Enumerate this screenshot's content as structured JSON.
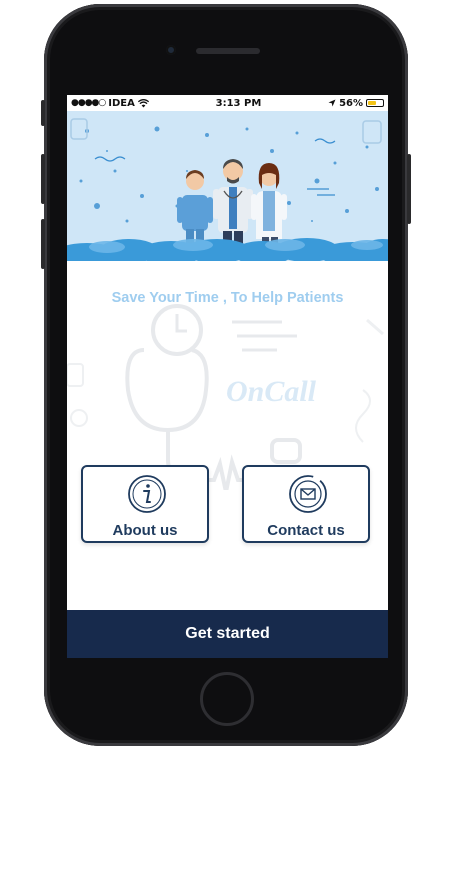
{
  "status_bar": {
    "carrier": "IDEA",
    "time": "3:13 PM",
    "battery_percent": "56%",
    "battery_level": 0.56,
    "icons": [
      "signal-dots-icon",
      "wifi-icon",
      "location-arrow-icon",
      "battery-icon"
    ]
  },
  "banner": {
    "illustration": "three-doctors-illustration",
    "colors": {
      "background": "#cfe6f7",
      "clouds": "#3a9ad9"
    }
  },
  "main": {
    "tagline": "Save Your Time , To Help Patients",
    "logo_text": "OnCall"
  },
  "cards": {
    "about": {
      "label": "About us",
      "icon": "info-icon"
    },
    "contact": {
      "label": "Contact us",
      "icon": "envelope-icon"
    }
  },
  "footer": {
    "get_started_label": "Get started",
    "color": "#172a4c"
  }
}
